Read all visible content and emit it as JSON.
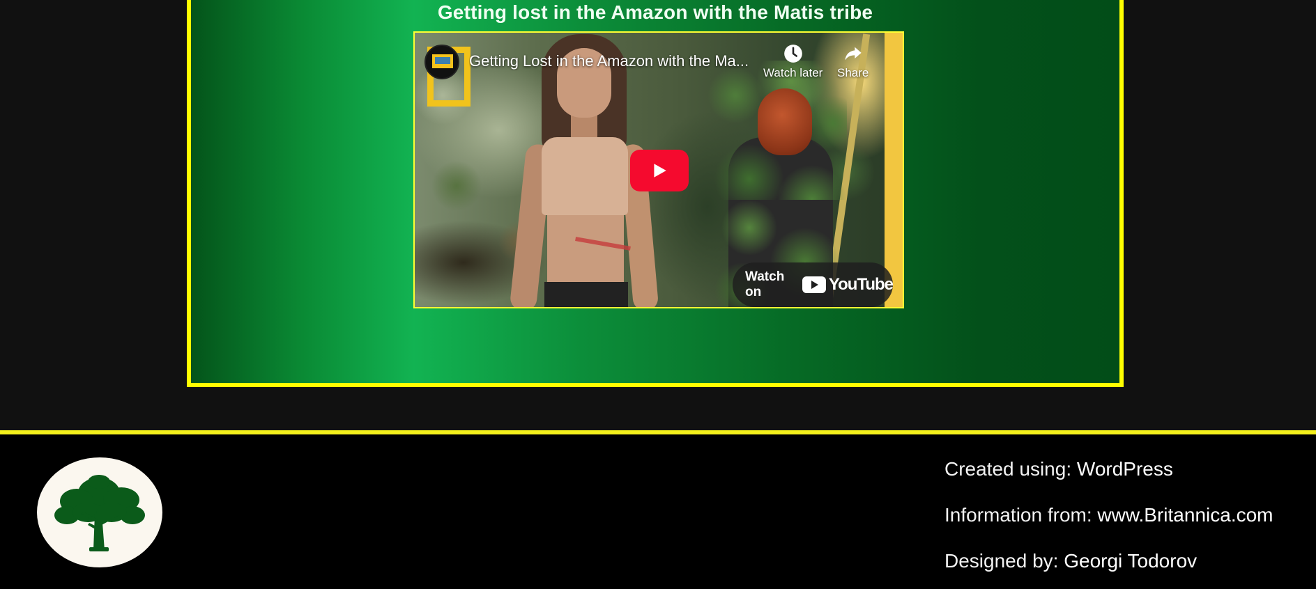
{
  "section": {
    "title": "Getting lost in the Amazon with the Matis tribe"
  },
  "video": {
    "overlay_title": "Getting Lost in the Amazon with the Ma...",
    "watch_later_label": "Watch later",
    "share_label": "Share",
    "watch_on_label": "Watch on",
    "youtube_wordmark": "YouTube",
    "play_button_color": "#f50a2e"
  },
  "footer": {
    "credits": [
      {
        "label": "Created using: ",
        "value": "WordPress"
      },
      {
        "label": "Information from: ",
        "value": "www.Britannica.com"
      },
      {
        "label": "Designed by: ",
        "value": "Georgi Todorov"
      }
    ],
    "logo_icon": "tree-icon"
  },
  "colors": {
    "accent_yellow": "#ffff00",
    "green_bright": "#12b352",
    "green_dark": "#024d18",
    "page_bg": "#111111",
    "footer_bg": "#000000"
  }
}
